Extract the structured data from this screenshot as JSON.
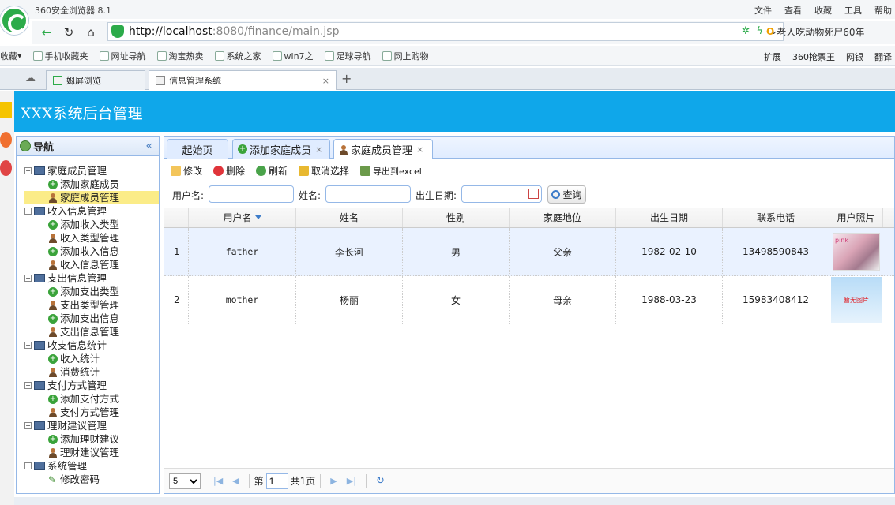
{
  "browser": {
    "window_title": "360安全浏览器 8.1",
    "menu": [
      "文件",
      "查看",
      "收藏",
      "工具",
      "帮助"
    ],
    "url_host": "http://localhost",
    "url_rest": ":8080/finance/main.jsp",
    "search_text": "老人吃动物死尸60年",
    "favorites": [
      "收藏",
      "手机收藏夹",
      "网址导航",
      "淘宝热卖",
      "系统之家",
      "win7之",
      "足球导航",
      "网上购物"
    ],
    "fav_right": [
      "扩展",
      "360抢票王",
      "网银",
      "翻译"
    ],
    "tabs": [
      {
        "label": "姆屏浏览"
      },
      {
        "label": "信息管理系统"
      }
    ]
  },
  "app": {
    "title": "XXX系统后台管理",
    "nav_title": "导航",
    "tree": [
      {
        "label": "家庭成员管理",
        "children": [
          {
            "label": "添加家庭成员",
            "icon": "add"
          },
          {
            "label": "家庭成员管理",
            "icon": "user",
            "selected": true
          }
        ]
      },
      {
        "label": "收入信息管理",
        "children": [
          {
            "label": "添加收入类型",
            "icon": "add"
          },
          {
            "label": "收入类型管理",
            "icon": "user"
          },
          {
            "label": "添加收入信息",
            "icon": "add"
          },
          {
            "label": "收入信息管理",
            "icon": "user"
          }
        ]
      },
      {
        "label": "支出信息管理",
        "children": [
          {
            "label": "添加支出类型",
            "icon": "add"
          },
          {
            "label": "支出类型管理",
            "icon": "user"
          },
          {
            "label": "添加支出信息",
            "icon": "add"
          },
          {
            "label": "支出信息管理",
            "icon": "user"
          }
        ]
      },
      {
        "label": "收支信息统计",
        "children": [
          {
            "label": "收入统计",
            "icon": "add"
          },
          {
            "label": "消费统计",
            "icon": "user"
          }
        ]
      },
      {
        "label": "支付方式管理",
        "children": [
          {
            "label": "添加支付方式",
            "icon": "add"
          },
          {
            "label": "支付方式管理",
            "icon": "user"
          }
        ]
      },
      {
        "label": "理财建议管理",
        "children": [
          {
            "label": "添加理财建议",
            "icon": "add"
          },
          {
            "label": "理财建议管理",
            "icon": "user"
          }
        ]
      },
      {
        "label": "系统管理",
        "children": [
          {
            "label": "修改密码",
            "icon": "pen"
          }
        ]
      }
    ],
    "tabs": {
      "home": "起始页",
      "add_member": "添加家庭成员",
      "member_mgmt": "家庭成员管理"
    },
    "toolbar": {
      "edit": "修改",
      "delete": "删除",
      "refresh": "刷新",
      "cancel_select": "取消选择",
      "export": "导出到excel"
    },
    "search": {
      "username_label": "用户名:",
      "name_label": "姓名:",
      "birth_label": "出生日期:",
      "query": "查询"
    },
    "grid": {
      "columns": [
        "用户名",
        "姓名",
        "性别",
        "家庭地位",
        "出生日期",
        "联系电话",
        "用户照片"
      ],
      "rows": [
        {
          "no": "1",
          "username": "father",
          "name": "李长河",
          "gender": "男",
          "role": "父亲",
          "birth": "1982-02-10",
          "phone": "13498590843",
          "photo_text": "pink"
        },
        {
          "no": "2",
          "username": "mother",
          "name": "杨丽",
          "gender": "女",
          "role": "母亲",
          "birth": "1988-03-23",
          "phone": "15983408412",
          "photo_text": "暂无图片"
        }
      ]
    },
    "pager": {
      "page_size": "5",
      "page_prefix": "第",
      "page_num": "1",
      "page_total": "共1页"
    }
  }
}
